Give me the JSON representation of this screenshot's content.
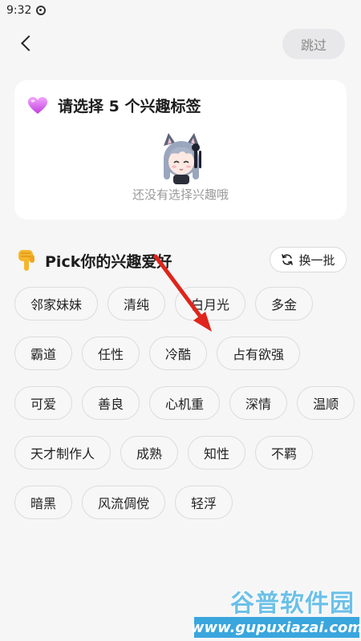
{
  "status_bar": {
    "time": "9:32"
  },
  "header": {
    "skip_label": "跳过"
  },
  "selection_card": {
    "title": "请选择 5 个兴趣标签",
    "empty_text": "还没有选择兴趣哦"
  },
  "pick_section": {
    "title": "Pick你的兴趣爱好",
    "refresh_label": "换一批"
  },
  "tags": [
    [
      "邻家妹妹",
      "清纯",
      "白月光",
      "多金"
    ],
    [
      "霸道",
      "任性",
      "冷酷",
      "占有欲强"
    ],
    [
      "可爱",
      "善良",
      "心机重",
      "深情",
      "温顺"
    ],
    [
      "天才制作人",
      "成熟",
      "知性",
      "不羁"
    ],
    [
      "暗黑",
      "风流倜傥",
      "轻浮"
    ]
  ],
  "watermark": {
    "top": "谷普软件园",
    "bottom": "www.gupuxiazai.com"
  },
  "colors": {
    "annotation_arrow": "#e0251b",
    "heart": "#d65be9"
  }
}
